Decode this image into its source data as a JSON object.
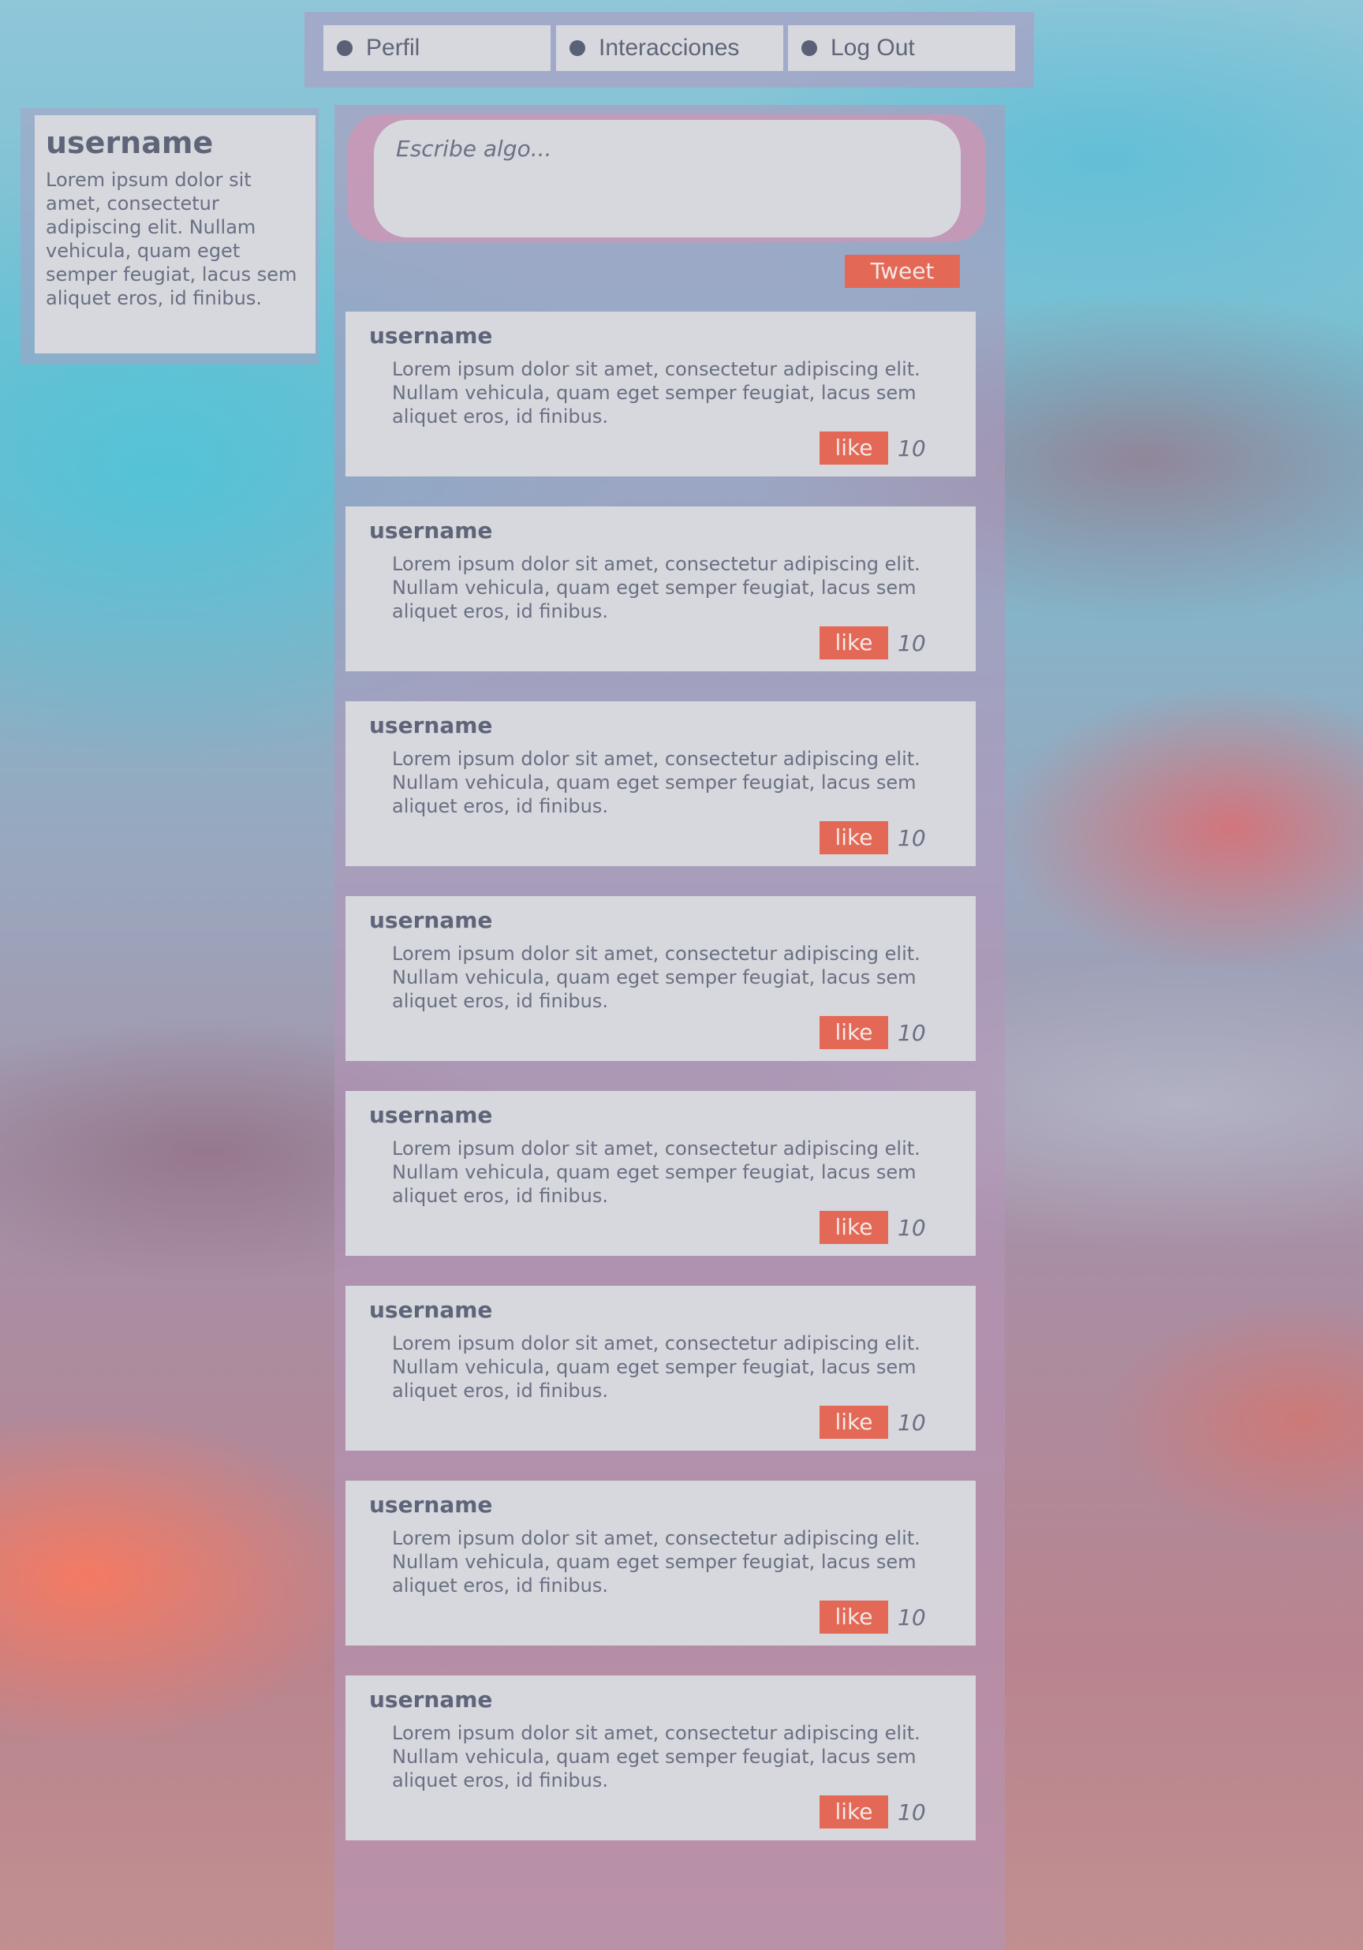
{
  "nav": {
    "items": [
      {
        "label": "Perfil"
      },
      {
        "label": "Interacciones"
      },
      {
        "label": "Log Out"
      }
    ]
  },
  "profile": {
    "username": "username",
    "bio": "Lorem ipsum dolor sit amet, consectetur adipiscing elit. Nullam vehicula, quam eget semper feugiat, lacus sem aliquet eros, id finibus."
  },
  "compose": {
    "placeholder": "Escribe algo...",
    "button_label": "Tweet"
  },
  "posts": [
    {
      "username": "username",
      "text": "Lorem ipsum dolor sit amet, consectetur adipiscing elit. Nullam vehicula, quam eget semper feugiat, lacus sem aliquet eros, id finibus.",
      "like_label": "like",
      "likes": "10"
    },
    {
      "username": "username",
      "text": "Lorem ipsum dolor sit amet, consectetur adipiscing elit. Nullam vehicula, quam eget semper feugiat, lacus sem aliquet eros, id finibus.",
      "like_label": "like",
      "likes": "10"
    },
    {
      "username": "username",
      "text": "Lorem ipsum dolor sit amet, consectetur adipiscing elit. Nullam vehicula, quam eget semper feugiat, lacus sem aliquet eros, id finibus.",
      "like_label": "like",
      "likes": "10"
    },
    {
      "username": "username",
      "text": "Lorem ipsum dolor sit amet, consectetur adipiscing elit. Nullam vehicula, quam eget semper feugiat, lacus sem aliquet eros, id finibus.",
      "like_label": "like",
      "likes": "10"
    },
    {
      "username": "username",
      "text": "Lorem ipsum dolor sit amet, consectetur adipiscing elit. Nullam vehicula, quam eget semper feugiat, lacus sem aliquet eros, id finibus.",
      "like_label": "like",
      "likes": "10"
    },
    {
      "username": "username",
      "text": "Lorem ipsum dolor sit amet, consectetur adipiscing elit. Nullam vehicula, quam eget semper feugiat, lacus sem aliquet eros, id finibus.",
      "like_label": "like",
      "likes": "10"
    },
    {
      "username": "username",
      "text": "Lorem ipsum dolor sit amet, consectetur adipiscing elit. Nullam vehicula, quam eget semper feugiat, lacus sem aliquet eros, id finibus.",
      "like_label": "like",
      "likes": "10"
    },
    {
      "username": "username",
      "text": "Lorem ipsum dolor sit amet, consectetur adipiscing elit. Nullam vehicula, quam eget semper feugiat, lacus sem aliquet eros, id finibus.",
      "like_label": "like",
      "likes": "10"
    }
  ],
  "colors": {
    "accent": "#e46856",
    "card": "#d6d8de",
    "text": "#5f6478"
  }
}
